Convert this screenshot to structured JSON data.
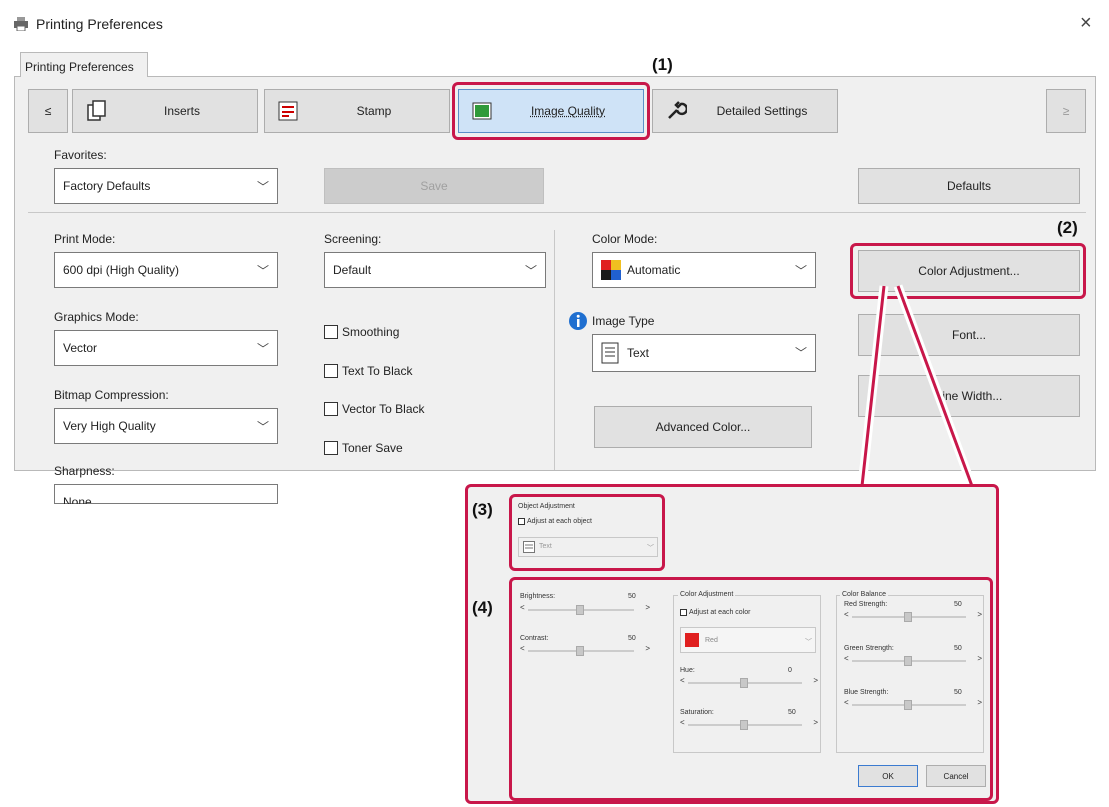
{
  "window": {
    "title": "Printing Preferences",
    "close": "×"
  },
  "main_tab": "Printing Preferences",
  "nav": {
    "prev": "≤",
    "next": "≥"
  },
  "tabs": [
    {
      "label": "Inserts",
      "icon": "inserts-icon"
    },
    {
      "label": "Stamp",
      "icon": "stamp-icon"
    },
    {
      "label": "Image Quality",
      "icon": "image-quality-icon"
    },
    {
      "label": "Detailed Settings",
      "icon": "wrench-icon"
    }
  ],
  "favorites": {
    "label": "Favorites:",
    "value": "Factory Defaults",
    "save": "Save",
    "defaults": "Defaults"
  },
  "print_mode": {
    "label": "Print Mode:",
    "value": "600 dpi (High Quality)"
  },
  "graphics_mode": {
    "label": "Graphics Mode:",
    "value": "Vector"
  },
  "bitmap": {
    "label": "Bitmap Compression:",
    "value": "Very High Quality"
  },
  "sharpness": {
    "label": "Sharpness:",
    "value": "None"
  },
  "screening": {
    "label": "Screening:",
    "value": "Default"
  },
  "checks": {
    "smoothing": "Smoothing",
    "text_black": "Text To Black",
    "vector_black": "Vector To Black",
    "toner_save": "Toner Save"
  },
  "color_mode": {
    "label": "Color Mode:",
    "value": "Automatic"
  },
  "image_type": {
    "label": "Image Type",
    "value": "Text"
  },
  "advanced_color": "Advanced Color...",
  "right_buttons": {
    "color_adjustment": "Color Adjustment...",
    "font": "Font...",
    "line_width": "Line Width..."
  },
  "callouts": {
    "c1": "(1)",
    "c2": "(2)",
    "c3": "(3)",
    "c4": "(4)"
  },
  "dialog": {
    "object_adjustment": "Object Adjustment",
    "adjust_each_object": "Adjust at each object",
    "object_value": "Text",
    "brightness": {
      "label": "Brightness:",
      "value": "50"
    },
    "contrast": {
      "label": "Contrast:",
      "value": "50"
    },
    "color_adjustment": "Color Adjustment",
    "adjust_each_color": "Adjust at each color",
    "color_value": "Red",
    "hue": {
      "label": "Hue:",
      "value": "0"
    },
    "saturation": {
      "label": "Saturation:",
      "value": "50"
    },
    "color_balance": "Color Balance",
    "red": {
      "label": "Red Strength:",
      "value": "50"
    },
    "green": {
      "label": "Green Strength:",
      "value": "50"
    },
    "blue": {
      "label": "Blue Strength:",
      "value": "50"
    },
    "ok": "OK",
    "cancel": "Cancel",
    "slider_left": "<",
    "slider_right": ">"
  },
  "colors": {
    "accent": "#c8174a",
    "red_swatch": "#e02020"
  }
}
